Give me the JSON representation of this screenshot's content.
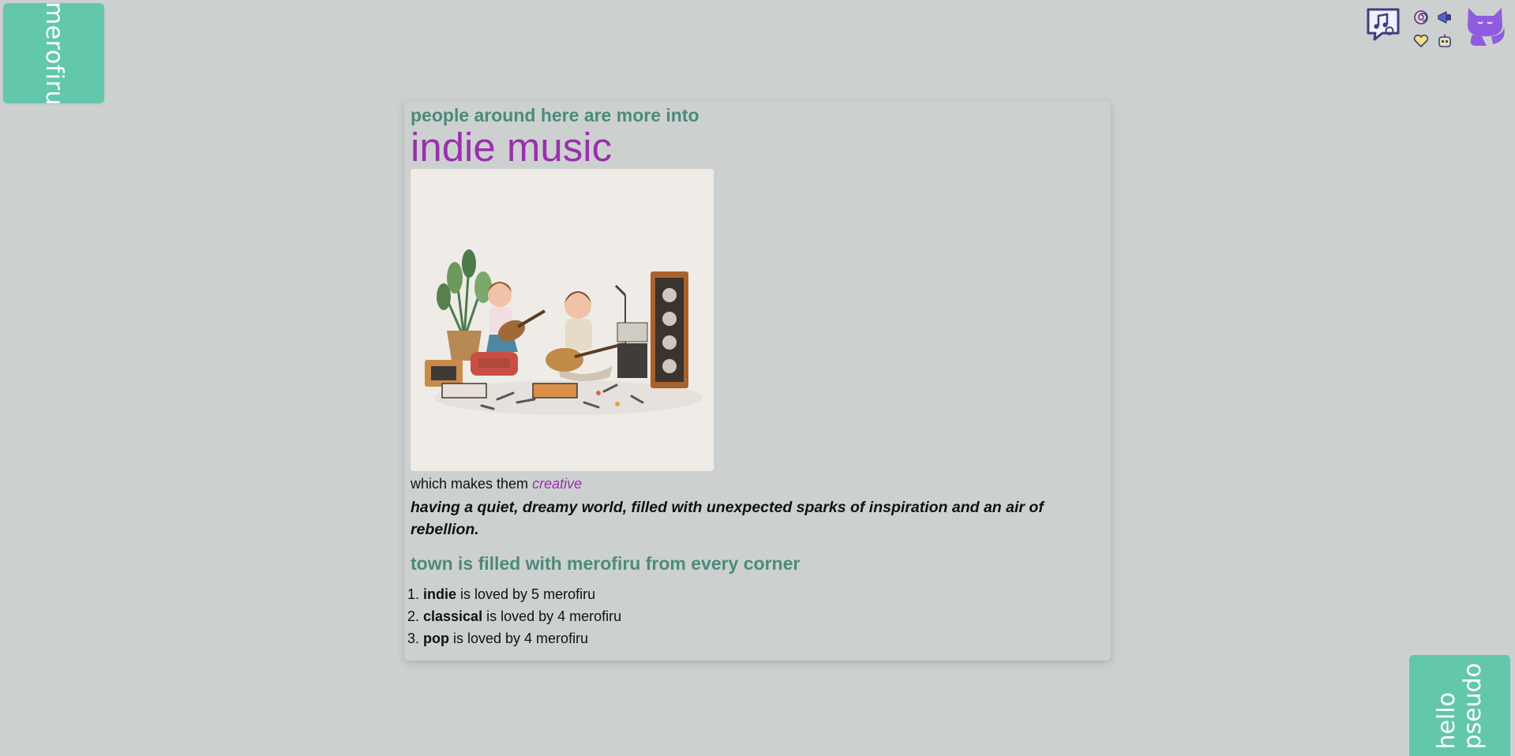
{
  "brand": {
    "label": "merofiru"
  },
  "header_icons": {
    "music_bubble": "music-chat-icon",
    "mini": [
      "spiral-icon",
      "megaphone-icon",
      "heart-icon",
      "robot-icon"
    ],
    "mascot": "cat-mascot-icon"
  },
  "colors": {
    "background": "#ccd1d0",
    "accent_teal": "#63c7ac",
    "heading_green": "#4d8a7b",
    "highlight_purple": "#9a2fad",
    "mascot_purple": "#8f5ce0"
  },
  "card": {
    "intro": "people around here are more into",
    "topic": "indie music",
    "image_alt": "watercolor illustration of two kids playing guitars with music gear",
    "trait_prefix": "which makes them",
    "trait": "creative",
    "trait_description": "having a quiet, dreamy world, filled with unexpected sparks of inspiration and an air of rebellion.",
    "ranking_title": "town is filled with merofiru from every corner",
    "ranking": [
      {
        "genre": "indie",
        "text": " is loved by 5 merofiru"
      },
      {
        "genre": "classical",
        "text": " is loved by 4 merofiru"
      },
      {
        "genre": "pop",
        "text": " is loved by 4 merofiru"
      }
    ]
  },
  "greeting": {
    "label": "hello\npseudo"
  }
}
